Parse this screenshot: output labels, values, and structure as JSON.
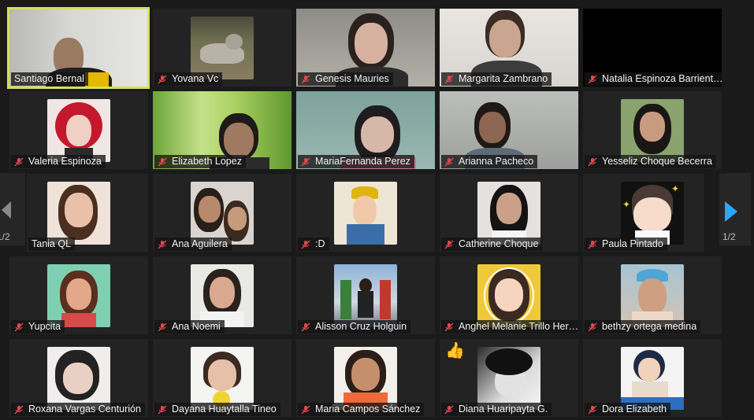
{
  "meeting": {
    "page_indicator": "1/2",
    "reaction_emoji": "👍"
  },
  "participants": [
    {
      "name": "Santiago Bernal",
      "muted": false,
      "video": "office",
      "speaking": true
    },
    {
      "name": "Yovana Vc",
      "muted": true,
      "video": "cat"
    },
    {
      "name": "Genesis Mauries",
      "muted": true,
      "video": "person-dark"
    },
    {
      "name": "Margarita Zambrano",
      "muted": true,
      "video": "person-light"
    },
    {
      "name": "Natalia Espinoza Barrientos",
      "muted": true,
      "video": "black"
    },
    {
      "name": "Valeria Espinoza",
      "muted": true,
      "video": "avatar-red"
    },
    {
      "name": "Elizabeth Lopez",
      "muted": true,
      "video": "grass"
    },
    {
      "name": "MariaFernanda Perez",
      "muted": true,
      "video": "person-teal"
    },
    {
      "name": "Arianna Pacheco",
      "muted": true,
      "video": "person-grey"
    },
    {
      "name": "Yesseliz Choque Becerra",
      "muted": true,
      "video": "avatar-photo"
    },
    {
      "name": "Tania QL",
      "muted": true,
      "video": "avatar-photo"
    },
    {
      "name": "Ana Aguilera",
      "muted": true,
      "video": "avatar-photo"
    },
    {
      "name": ":D",
      "muted": true,
      "video": "avatar-cartoon"
    },
    {
      "name": "Catherine Choque",
      "muted": true,
      "video": "avatar-photo"
    },
    {
      "name": "Paula Pintado",
      "muted": true,
      "video": "avatar-cartoon-girl"
    },
    {
      "name": "Yupcita",
      "muted": true,
      "video": "avatar-cartoon"
    },
    {
      "name": "Ana Noemi",
      "muted": true,
      "video": "avatar-photo"
    },
    {
      "name": "Alisson Cruz Holguin",
      "muted": true,
      "video": "avatar-photo"
    },
    {
      "name": "Anghel Melanie Trillo Herrera",
      "muted": true,
      "video": "avatar-cartoon-yellow"
    },
    {
      "name": "bethzy ortega medina",
      "muted": true,
      "video": "avatar-photo"
    },
    {
      "name": "Roxana Vargas Centurión",
      "muted": true,
      "video": "avatar-photo"
    },
    {
      "name": "Dayana Huaytalla Tineo",
      "muted": true,
      "video": "avatar-photo"
    },
    {
      "name": "Maria Campos Sánchez",
      "muted": true,
      "video": "avatar-photo"
    },
    {
      "name": "Diana Huaripayta G.",
      "muted": true,
      "video": "avatar-bw"
    },
    {
      "name": "Dora Elizabeth",
      "muted": true,
      "video": "avatar-cartoon"
    }
  ]
}
